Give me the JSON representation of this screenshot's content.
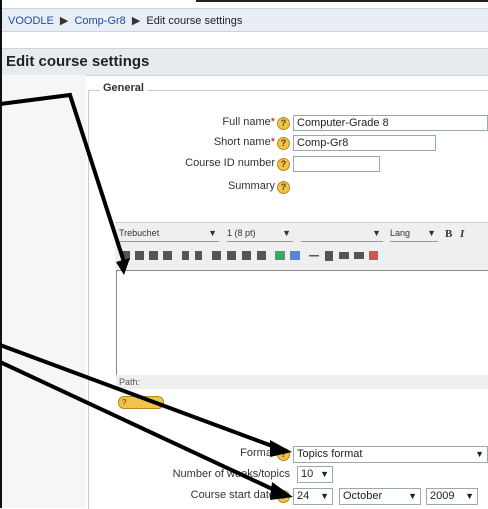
{
  "breadcrumb": {
    "root": "VOODLE",
    "course": "Comp-Gr8",
    "current": "Edit course settings",
    "separator": "▶"
  },
  "page_title": "Edit course settings",
  "section_legend": "General",
  "fields": {
    "full_name": {
      "label": "Full name",
      "required_mark": "*",
      "value": "Computer-Grade 8"
    },
    "short_name": {
      "label": "Short name",
      "required_mark": "*",
      "value": "Comp-Gr8"
    },
    "course_id": {
      "label": "Course ID number",
      "value": ""
    },
    "summary": {
      "label": "Summary"
    }
  },
  "editor_toolbar": {
    "font": "Trebuchet",
    "size": "1 (8 pt)",
    "lang": "Lang",
    "bold": "B",
    "italic": "I"
  },
  "editor_path_label": "Path:",
  "help_badge_text": "?",
  "format": {
    "label": "Format",
    "value": "Topics format"
  },
  "weeks": {
    "label": "Number of weeks/topics",
    "value": "10"
  },
  "start_date": {
    "label": "Course start date",
    "day": "24",
    "month": "October",
    "year": "2009"
  },
  "help_glyph": "?",
  "colors": {
    "annotation_arrows": "#000000",
    "help_icon": "#f1c34a",
    "link": "#1c4fa0"
  }
}
